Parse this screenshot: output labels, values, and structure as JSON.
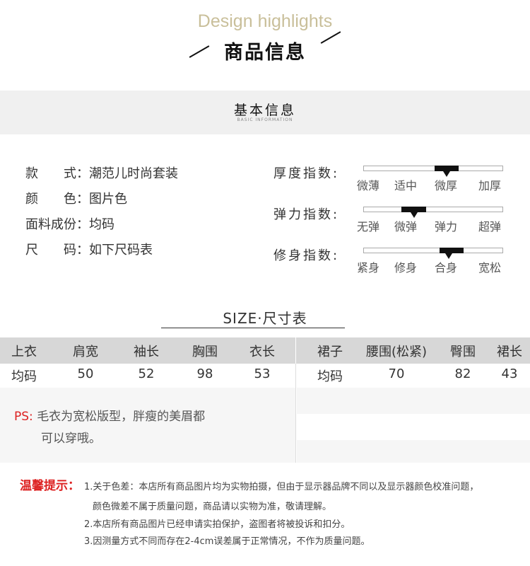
{
  "header": {
    "highlight": "Design highlights",
    "title": "商品信息"
  },
  "band": {
    "title": "基本信息",
    "subtitle": "BASIC INFORMATION"
  },
  "basic_info": [
    {
      "label": "款　　式：",
      "value": "潮范儿时尚套装"
    },
    {
      "label": "颜　　色：",
      "value": "图片色"
    },
    {
      "label": "面料成份：",
      "value": "均码"
    },
    {
      "label": "尺　　码：",
      "value": "如下尺码表"
    }
  ],
  "indices": [
    {
      "label": "厚度指数:",
      "levels": [
        "微薄",
        "适中",
        "微厚",
        "加厚"
      ],
      "selected_index": 2
    },
    {
      "label": "弹力指数:",
      "levels": [
        "无弹",
        "微弹",
        "弹力",
        "超弹"
      ],
      "selected_index": 1
    },
    {
      "label": "修身指数:",
      "levels": [
        "紧身",
        "修身",
        "合身",
        "宽松"
      ],
      "selected_index": 2
    }
  ],
  "size_table": {
    "title": "SIZE·尺寸表",
    "top_headers": [
      "上衣",
      "肩宽",
      "袖长",
      "胸围",
      "衣长"
    ],
    "top_values": [
      "均码",
      "50",
      "52",
      "98",
      "53"
    ],
    "skirt_headers": [
      "裙子",
      "腰围(松紧)",
      "臀围",
      "裙长"
    ],
    "skirt_values": [
      "均码",
      "70",
      "82",
      "43"
    ]
  },
  "ps": {
    "prefix": "PS:",
    "line1": "毛衣为宽松版型，胖瘦的美眉都",
    "line2": "可以穿哦。"
  },
  "tips": {
    "heading": "温馨提示：",
    "lines": [
      "1.关于色差：本店所有商品图片均为实物拍摄，但由于显示器品牌不同以及显示器颜色校准问题，",
      "颜色微差不属于质量问题，商品请以实物为准，敬请理解。",
      "2.本店所有商品图片已经申请实拍保护，盗图者将被投诉和扣分。",
      "3.因测量方式不同而存在2-4cm误差属于正常情况，不作为质量问题。"
    ]
  },
  "colors": {
    "highlight": "#c9bf9a",
    "accent_red": "#dd2222",
    "header_grey": "#d7d7d7",
    "band_grey": "#f0f0f0"
  }
}
